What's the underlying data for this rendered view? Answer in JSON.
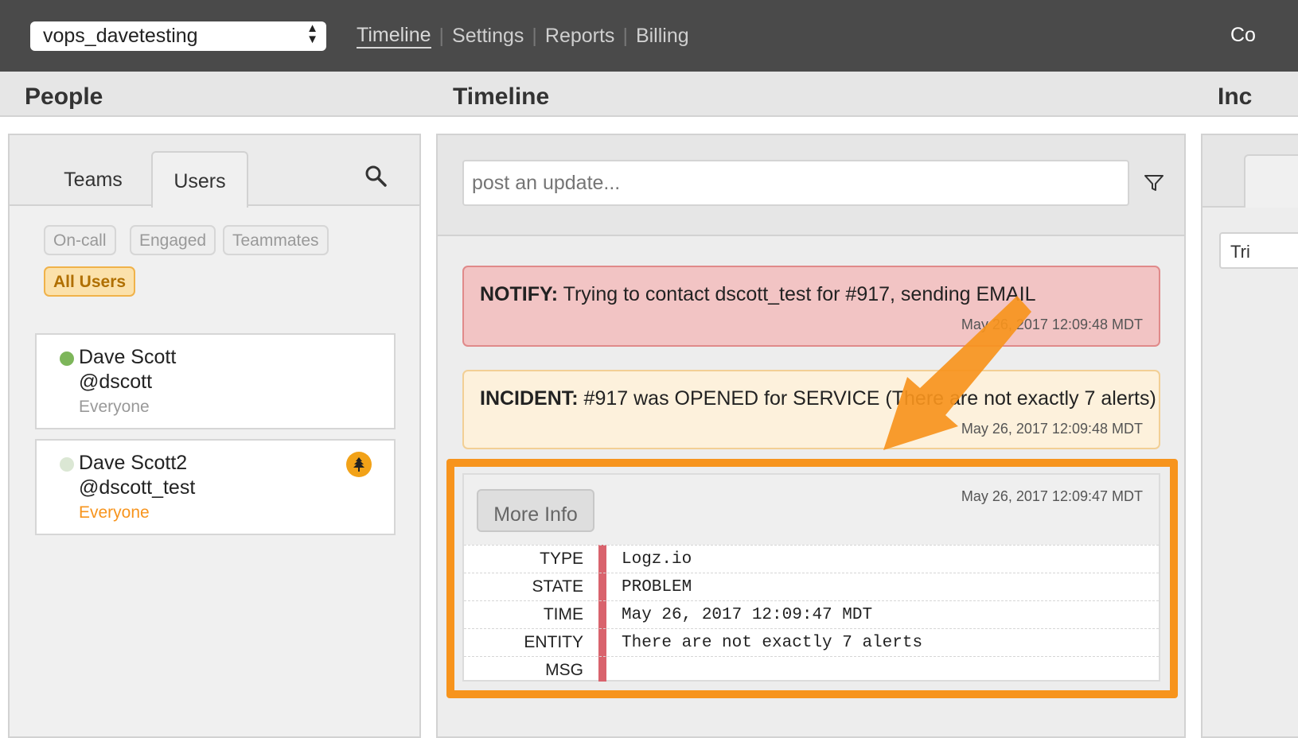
{
  "topbar": {
    "org_select": "vops_davetesting",
    "nav": [
      "Timeline",
      "Settings",
      "Reports",
      "Billing"
    ],
    "cut_text": "Co"
  },
  "sections": {
    "people": "People",
    "timeline": "Timeline",
    "incidents": "Inc"
  },
  "people": {
    "tabs": [
      "Teams",
      "Users"
    ],
    "filters": [
      "On-call",
      "Engaged",
      "Teammates",
      "All Users"
    ],
    "users": [
      {
        "name": "Dave Scott",
        "handle": "@dscott",
        "team": "Everyone",
        "status_color": "#7db65a",
        "team_color": "#999999"
      },
      {
        "name": "Dave Scott2",
        "handle": "@dscott_test",
        "team": "Everyone",
        "status_color": "#dbe7d4",
        "team_color": "#f7941d",
        "badge_icon": "leaf-icon"
      }
    ]
  },
  "timeline": {
    "update_placeholder": "post an update...",
    "events": [
      {
        "label": "NOTIFY:",
        "text": " Trying to contact dscott_test for #917, sending EMAIL",
        "time": "May 26, 2017 12:09:48 MDT"
      },
      {
        "label": "INCIDENT:",
        "text": " #917 was OPENED for SERVICE (There are not exactly 7 alerts)",
        "time": "May 26, 2017 12:09:48 MDT"
      }
    ],
    "alert": {
      "more_info": "More Info",
      "time": "May 26, 2017 12:09:47 MDT",
      "rows": [
        {
          "k": "TYPE",
          "v": "Logz.io"
        },
        {
          "k": "STATE",
          "v": "PROBLEM"
        },
        {
          "k": "TIME",
          "v": "May 26, 2017 12:09:47 MDT"
        },
        {
          "k": "ENTITY",
          "v": "There are not exactly 7 alerts"
        },
        {
          "k": "MSG",
          "v": ""
        }
      ]
    },
    "highlight_color": "#f7941d"
  },
  "incidents": {
    "input_text": "Tri"
  }
}
